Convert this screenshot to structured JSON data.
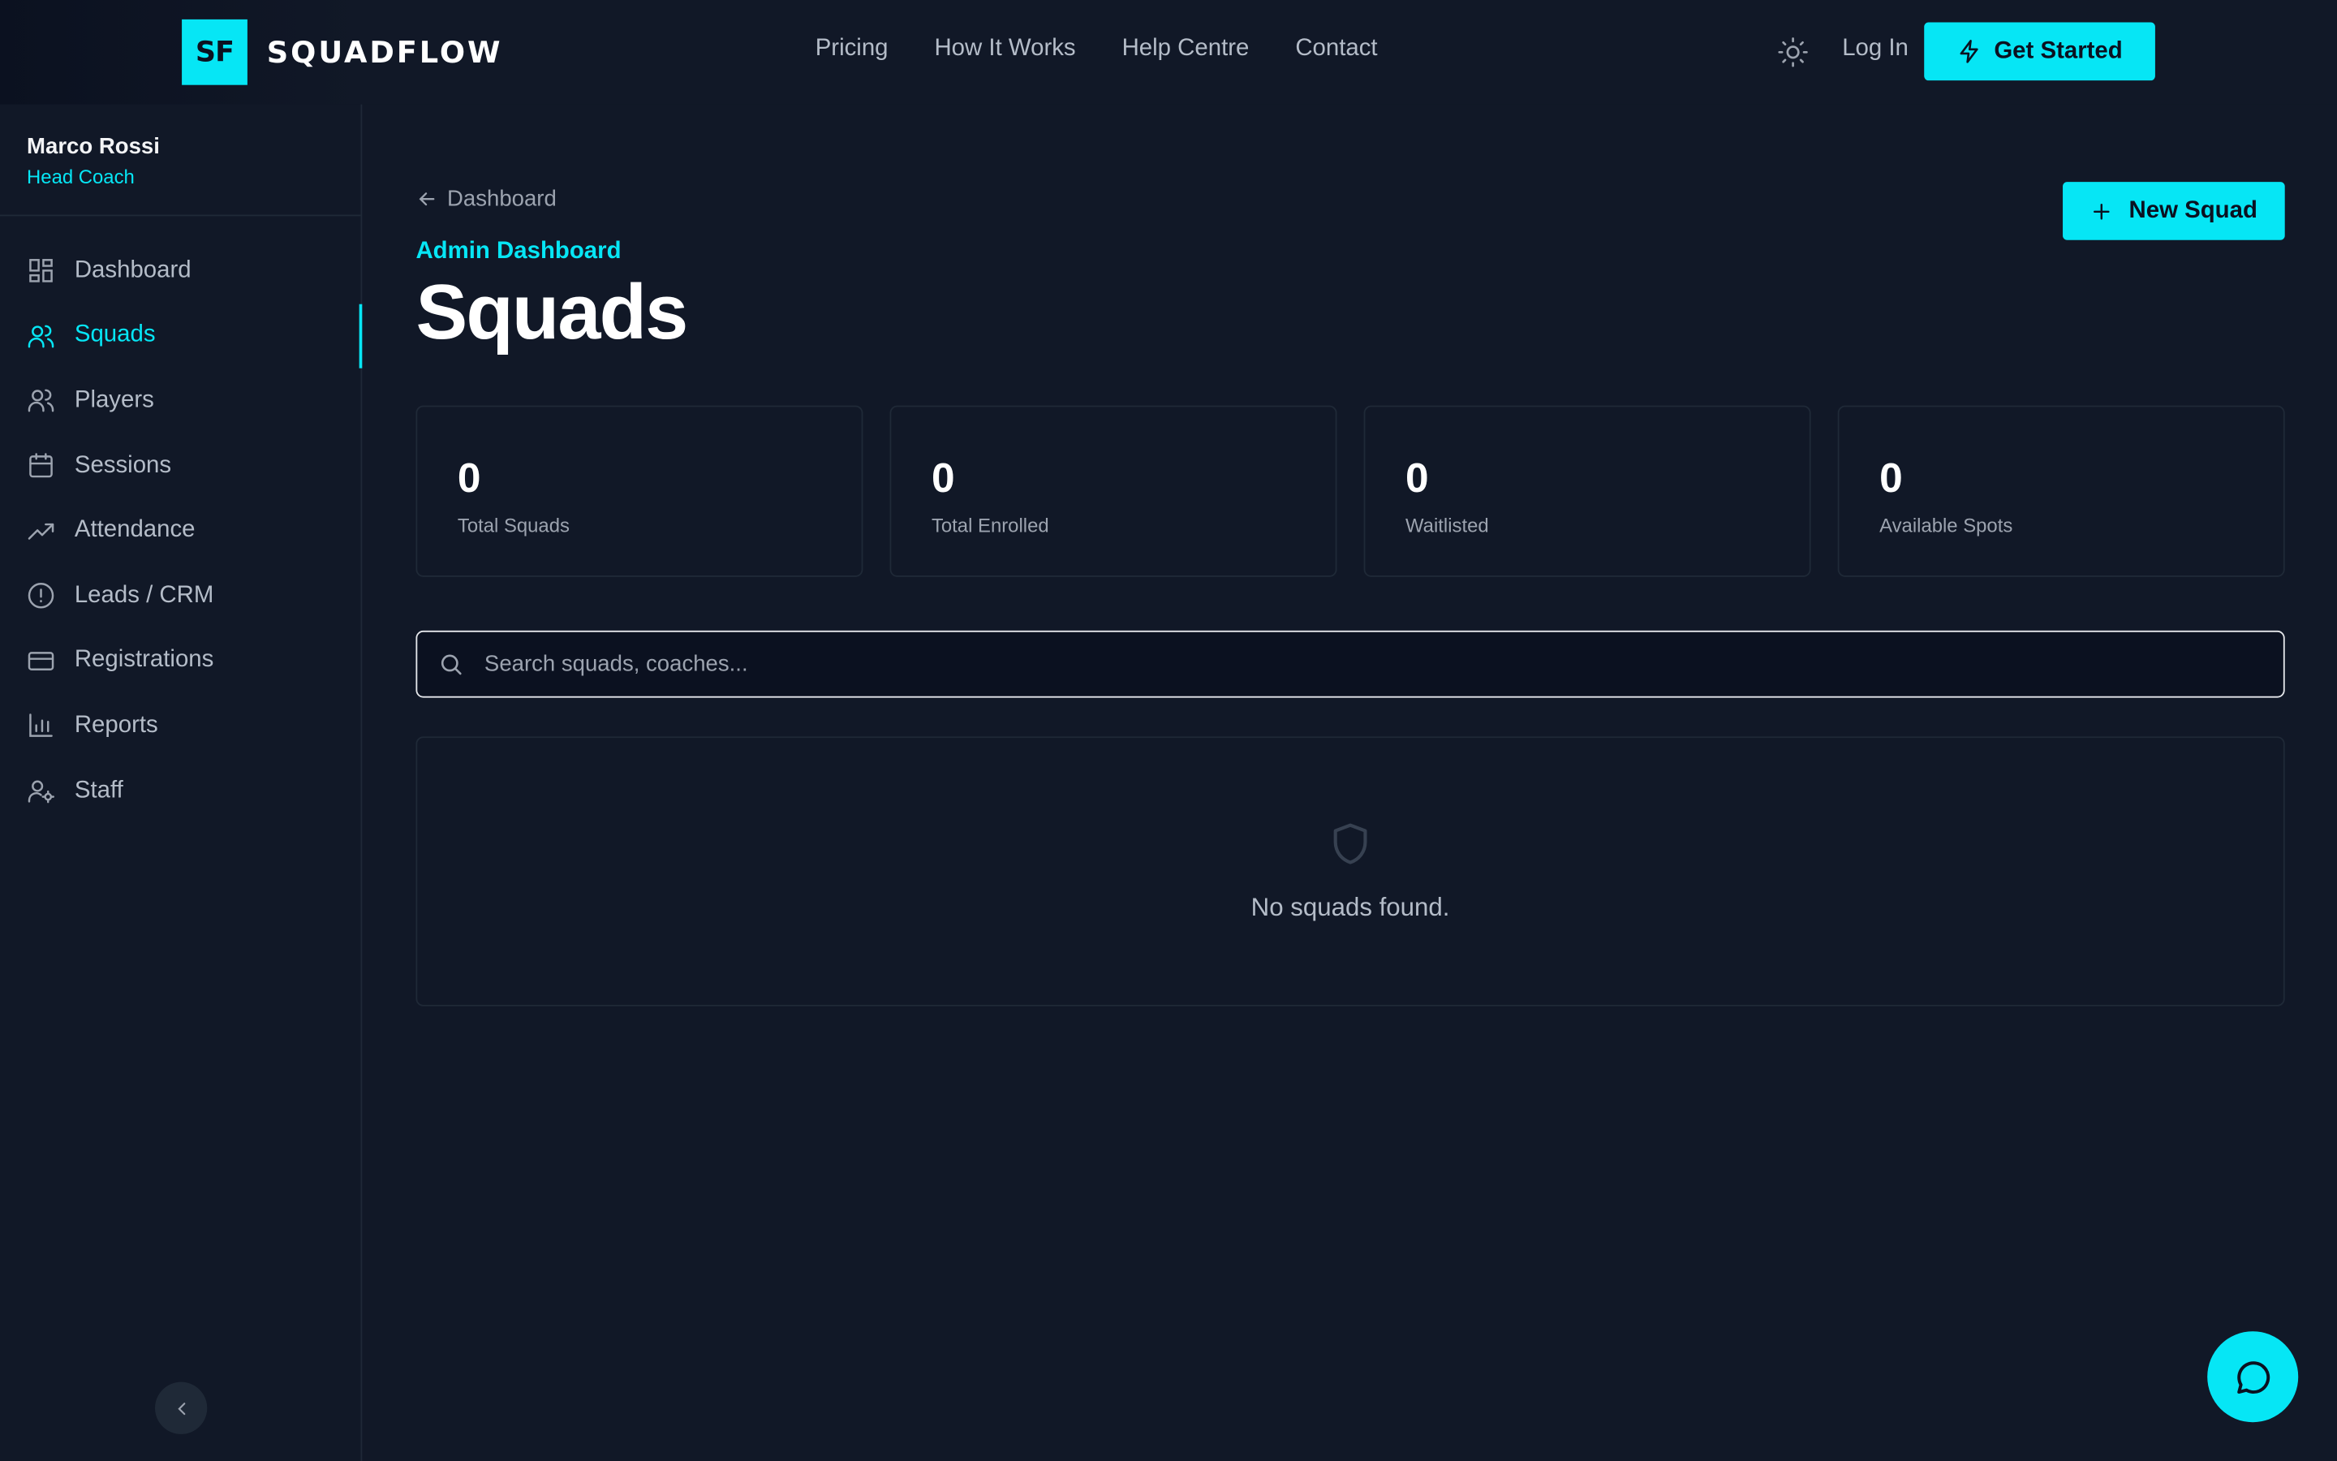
{
  "brand": {
    "mark": "SF",
    "name": "SQUADFLOW"
  },
  "topnav": {
    "links": [
      "Pricing",
      "How It Works",
      "Help Centre",
      "Contact"
    ],
    "login": "Log In",
    "cta": "Get Started"
  },
  "sidebar": {
    "user_name": "Marco Rossi",
    "user_role": "Head Coach",
    "items": [
      {
        "label": "Dashboard",
        "icon": "grid-icon"
      },
      {
        "label": "Squads",
        "icon": "users-icon",
        "active": true
      },
      {
        "label": "Players",
        "icon": "users-icon"
      },
      {
        "label": "Sessions",
        "icon": "calendar-icon"
      },
      {
        "label": "Attendance",
        "icon": "trending-up-icon"
      },
      {
        "label": "Leads / CRM",
        "icon": "alert-circle-icon"
      },
      {
        "label": "Registrations",
        "icon": "credit-card-icon"
      },
      {
        "label": "Reports",
        "icon": "bar-chart-icon"
      },
      {
        "label": "Staff",
        "icon": "user-cog-icon"
      }
    ]
  },
  "main": {
    "back_label": "Dashboard",
    "eyebrow": "Admin Dashboard",
    "title": "Squads",
    "new_button": "New Squad",
    "stats": [
      {
        "value": "0",
        "label": "Total Squads"
      },
      {
        "value": "0",
        "label": "Total Enrolled"
      },
      {
        "value": "0",
        "label": "Waitlisted"
      },
      {
        "value": "0",
        "label": "Available Spots"
      }
    ],
    "search_placeholder": "Search squads, coaches...",
    "empty_message": "No squads found."
  },
  "colors": {
    "accent": "#06e6f5",
    "background": "#111827"
  }
}
